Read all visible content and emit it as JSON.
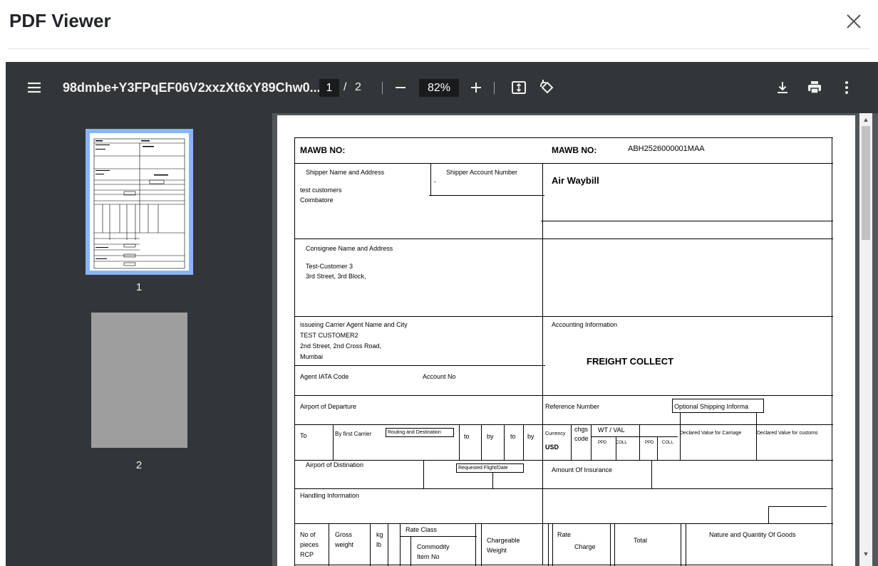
{
  "modal": {
    "title": "PDF Viewer",
    "close_icon": "close-icon"
  },
  "toolbar": {
    "menu_icon": "menu-icon",
    "filename": "98dmbe+Y3FPqEF06V2xxzXt6xY89Chw0...",
    "page_current": "1",
    "page_separator": "/",
    "page_total": "2",
    "zoom": "82%",
    "icons": [
      "zoom-out-icon",
      "zoom-in-icon",
      "fit-page-icon",
      "rotate-icon",
      "download-icon",
      "print-icon",
      "more-icon"
    ]
  },
  "sidebar": {
    "thumbnails": [
      {
        "label": "1",
        "selected": true
      },
      {
        "label": "2",
        "selected": false
      }
    ]
  },
  "document": {
    "mawb_label_left": "MAWB NO:",
    "mawb_label_right": "MAWB NO:",
    "mawb_number": "ABH2526000001MAA",
    "shipper_name_label": "Shipper Name and Address",
    "shipper_account_label": "Shipper Account Number",
    "shipper_account_value": "-",
    "shipper_line1": "test customers",
    "shipper_line2": "Coimbatore",
    "air_waybill": "Air Waybill",
    "consignee_label": "Consignee Name and Address",
    "consignee_line1": "Test-Customer 3",
    "consignee_line2": "3rd Street, 3rd Block,",
    "carrier_label": "issueing Carrier Agent Name and City",
    "carrier_line1": "TEST CUSTOMER2",
    "carrier_line2": "2nd Street, 2nd Cross Road,",
    "carrier_line3": "Mumbai",
    "accounting_label": "Accounting Information",
    "freight": "FREIGHT COLLECT",
    "agent_iata_label": "Agent IATA Code",
    "account_no_label": "Account No",
    "airport_departure_label": "Airport of Departure",
    "reference_label": "Reference Number",
    "optional_shipping_label": "Optional Shipping Informa",
    "to_label": "To",
    "by_first_carrier_label": "By first Carrier",
    "routing_label": "Routing and Destination",
    "to2": "to",
    "by2": "by",
    "to3": "to",
    "by3": "by",
    "currency_label": "Currency",
    "currency_value": "USD",
    "chgs_label": "chgs",
    "code_label": "code",
    "wt_val_label": "WT / VAL",
    "ppd1": "PPD",
    "coll1": "COLL",
    "ppd2": "PPD",
    "coll2": "COLL",
    "declared_carriage_label": "Declared Value for Carriage",
    "declared_customs_label": "Declared Value for customs",
    "airport_destination_label": "Airport of Distination",
    "requested_flight_label": "Requested Flight/Date",
    "insurance_label": "Amount Of Insurance",
    "handling_label": "Handling Information",
    "no_of_label": "No of",
    "pieces_label": "pieces",
    "rcp_label": "RCP",
    "gross_label": "Gross",
    "weight_label": "weight",
    "kg_label": "kg",
    "lb_label": "lb",
    "rate_class_label": "Rate Class",
    "commodity_label": "Commodity",
    "item_no_label": "Item No",
    "chargeable_label": "Chargeable",
    "chargeable_weight_label": "Weight",
    "rate_label": "Rate",
    "charge_label": "Charge",
    "total_label": "Total",
    "nature_label": "Nature and Quantity Of Goods"
  }
}
